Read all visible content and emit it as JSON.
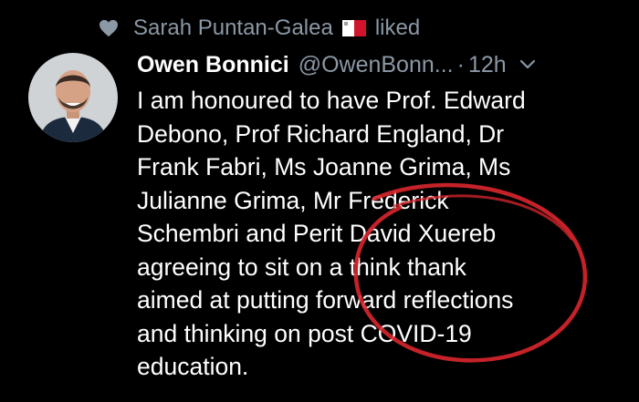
{
  "activity": {
    "liked_by": "Sarah Puntan-Galea",
    "action": "liked"
  },
  "icons": {
    "heart": "heart-icon",
    "flag": "malta-flag-icon",
    "more": "chevron-down-icon"
  },
  "tweet": {
    "author_name": "Owen Bonnici",
    "handle": "@OwenBonn...",
    "separator": "·",
    "time": "12h",
    "lines": [
      "I am honoured to have Prof. Edward",
      "Debono, Prof Richard England, Dr",
      "Frank Fabri, Ms Joanne Grima, Ms",
      "Julianne Grima, Mr Frederick",
      "Schembri and Perit David Xuereb",
      "agreeing to sit on a think thank",
      "aimed at putting forward reflections",
      "and thinking on post COVID-19",
      "education."
    ]
  },
  "colors": {
    "background": "#000000",
    "text": "#ffffff",
    "secondary": "#8b98a5",
    "annotation": "#d9262c",
    "flag_red": "#cf142b"
  }
}
